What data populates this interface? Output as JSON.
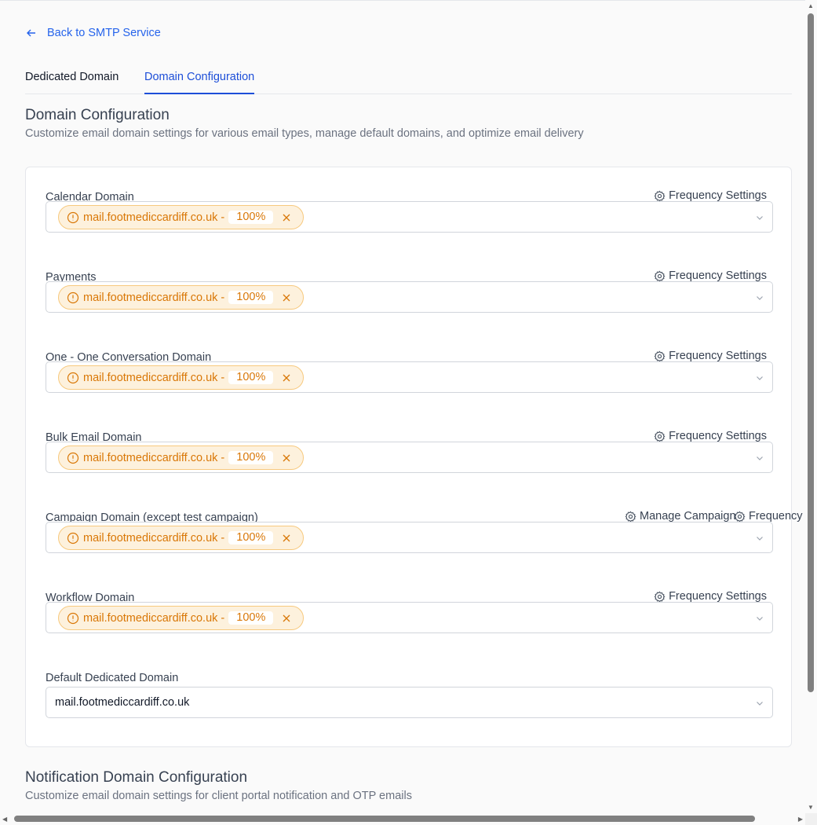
{
  "back_link": {
    "label": "Back to SMTP Service"
  },
  "tabs": [
    {
      "label": "Dedicated Domain",
      "active": false
    },
    {
      "label": "Domain Configuration",
      "active": true
    }
  ],
  "section": {
    "title": "Domain Configuration",
    "description": "Customize email domain settings for various email types, manage default domains, and optimize email delivery"
  },
  "fields": [
    {
      "label": "Calendar Domain",
      "actions": [
        "Frequency Settings"
      ],
      "tag": {
        "domain": "mail.footmediccardiff.co.uk -",
        "percent": "100%"
      }
    },
    {
      "label": "Payments",
      "actions": [
        "Frequency Settings"
      ],
      "tag": {
        "domain": "mail.footmediccardiff.co.uk -",
        "percent": "100%"
      }
    },
    {
      "label": "One - One Conversation Domain",
      "actions": [
        "Frequency Settings"
      ],
      "tag": {
        "domain": "mail.footmediccardiff.co.uk -",
        "percent": "100%"
      }
    },
    {
      "label": "Bulk Email Domain",
      "actions": [
        "Frequency Settings"
      ],
      "tag": {
        "domain": "mail.footmediccardiff.co.uk -",
        "percent": "100%"
      }
    },
    {
      "label": "Campaign Domain (except test campaign)",
      "actions": [
        "Manage Campaign",
        "Frequency"
      ],
      "tag": {
        "domain": "mail.footmediccardiff.co.uk -",
        "percent": "100%"
      }
    },
    {
      "label": "Workflow Domain",
      "actions": [
        "Frequency Settings"
      ],
      "tag": {
        "domain": "mail.footmediccardiff.co.uk -",
        "percent": "100%"
      }
    }
  ],
  "default_domain": {
    "label": "Default Dedicated Domain",
    "value": "mail.footmediccardiff.co.uk"
  },
  "notification_section": {
    "title": "Notification Domain Configuration",
    "description": "Customize email domain settings for client portal notification and OTP emails"
  },
  "colors": {
    "accent": "#1d4ed8",
    "tag_text": "#d97706",
    "tag_bg": "#fdf1dd"
  }
}
